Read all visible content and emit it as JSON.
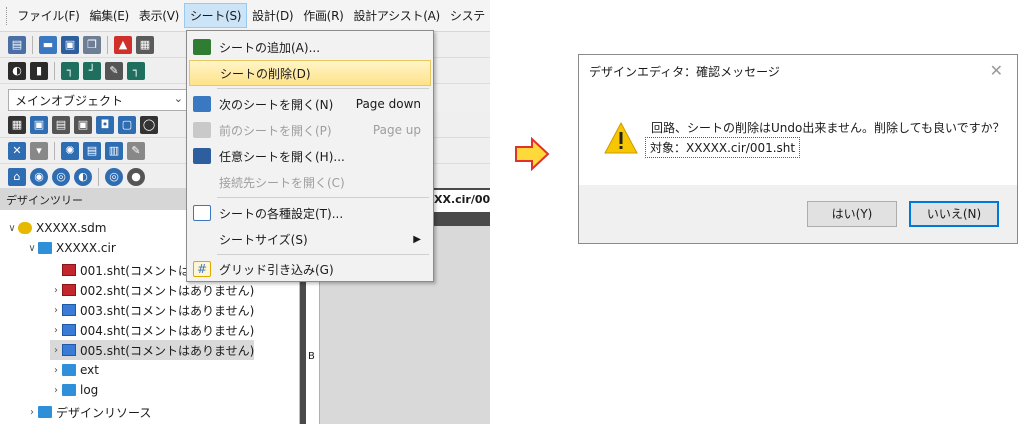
{
  "menubar": {
    "items": [
      "ファイル(F)",
      "編集(E)",
      "表示(V)",
      "シート(S)",
      "設計(D)",
      "作画(R)",
      "設計アシスト(A)",
      "システ"
    ],
    "active_index": 3
  },
  "object_selector": {
    "value": "メインオブジェクト"
  },
  "tree": {
    "header": "デザインツリー",
    "root": "XXXXX.sdm",
    "cir": "XXXXX.cir",
    "sheets": [
      "001.sht(コメントはあ",
      "002.sht(コメントはありません)",
      "003.sht(コメントはありません)",
      "004.sht(コメントはありません)",
      "005.sht(コメントはありません)"
    ],
    "folders": [
      "ext",
      "log"
    ],
    "resources": "デザインリソース"
  },
  "editor": {
    "tab_label": "XX.cir/00",
    "ruler_label": "B"
  },
  "dropdown": {
    "items": [
      {
        "label": "シートの追加(A)...",
        "shortcut": "",
        "icon": "add-sheet-icon",
        "disabled": false,
        "highlight": false
      },
      {
        "label": "シートの削除(D)",
        "shortcut": "",
        "icon": "",
        "disabled": false,
        "highlight": true
      },
      {
        "label": "次のシートを開く(N)",
        "shortcut": "Page down",
        "icon": "next-sheet-icon",
        "disabled": false,
        "highlight": false
      },
      {
        "label": "前のシートを開く(P)",
        "shortcut": "Page up",
        "icon": "prev-sheet-icon",
        "disabled": true,
        "highlight": false
      },
      {
        "label": "任意シートを開く(H)...",
        "shortcut": "",
        "icon": "open-sheet-icon",
        "disabled": false,
        "highlight": false
      },
      {
        "label": "接続先シートを開く(C)",
        "shortcut": "",
        "icon": "",
        "disabled": true,
        "highlight": false
      },
      {
        "label": "シートの各種設定(T)...",
        "shortcut": "",
        "icon": "sheet-settings-icon",
        "disabled": false,
        "highlight": false
      },
      {
        "label": "シートサイズ(S)",
        "shortcut": "▶",
        "icon": "",
        "disabled": false,
        "highlight": false
      },
      {
        "label": "グリッド引き込み(G)",
        "shortcut": "",
        "icon": "grid-snap-icon",
        "disabled": false,
        "highlight": false
      }
    ]
  },
  "dialog": {
    "title": "デザインエディタ：確認メッセージ",
    "message": "回路、シートの削除はUndo出来ません。削除しても良いですか？",
    "target": "対象：XXXXX.cir/001.sht",
    "yes_label": "はい(Y)",
    "no_label": "いいえ(N)",
    "close": "✕"
  },
  "colors": {
    "arrow_fill": "#ffd83a",
    "arrow_stroke": "#e0312b",
    "highlight": "#ffe28a",
    "dotted_border": "#d12a2a",
    "accent": "#0078d7"
  }
}
